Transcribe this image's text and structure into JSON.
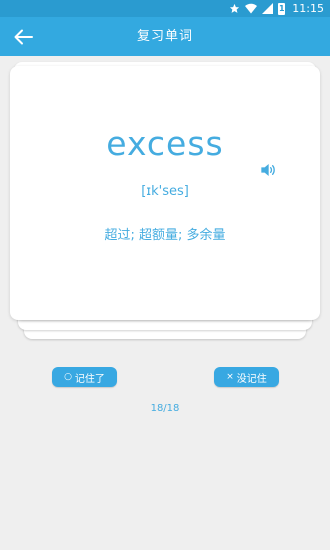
{
  "status_bar": {
    "time": "11:15",
    "icons": [
      "star-icon",
      "wifi-icon",
      "signal-icon",
      "battery-icon"
    ],
    "battery_level": "1"
  },
  "app_bar": {
    "back_icon": "arrow-left-icon",
    "title": "复习单词"
  },
  "card": {
    "word": "excess",
    "phonetic": "[ɪk'ses]",
    "meaning": "超过; 超额量; 多余量",
    "sound_icon": "speaker-icon"
  },
  "actions": {
    "remember_glyph": "○",
    "remember_label": "记住了",
    "forgot_glyph": "×",
    "forgot_label": "没记住"
  },
  "progress": "18/18",
  "colors": {
    "status_bar": "#2a9bd0",
    "app_bar": "#33a9e0",
    "accent": "#45ace0",
    "button": "#38a8e2",
    "background": "#efefef"
  }
}
